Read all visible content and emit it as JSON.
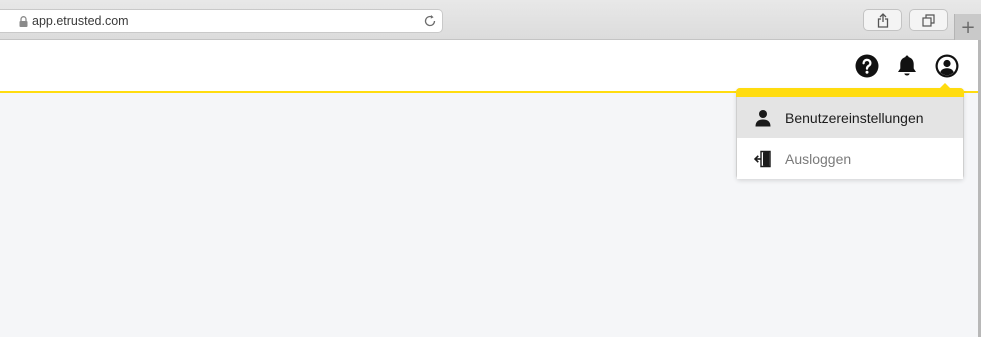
{
  "browser": {
    "url": "app.etrusted.com",
    "new_tab_symbol": "+"
  },
  "header": {
    "icons": [
      "help-icon",
      "bell-icon",
      "user-circle-icon"
    ]
  },
  "user_menu": {
    "items": [
      {
        "label": "Benutzereinstellungen",
        "icon": "user-icon",
        "active": true
      },
      {
        "label": "Ausloggen",
        "icon": "logout-icon",
        "active": false
      }
    ]
  },
  "colors": {
    "accent": "#ffdc0f",
    "active_item_bg": "#e4e4e4",
    "content_bg": "#f5f6f8"
  }
}
